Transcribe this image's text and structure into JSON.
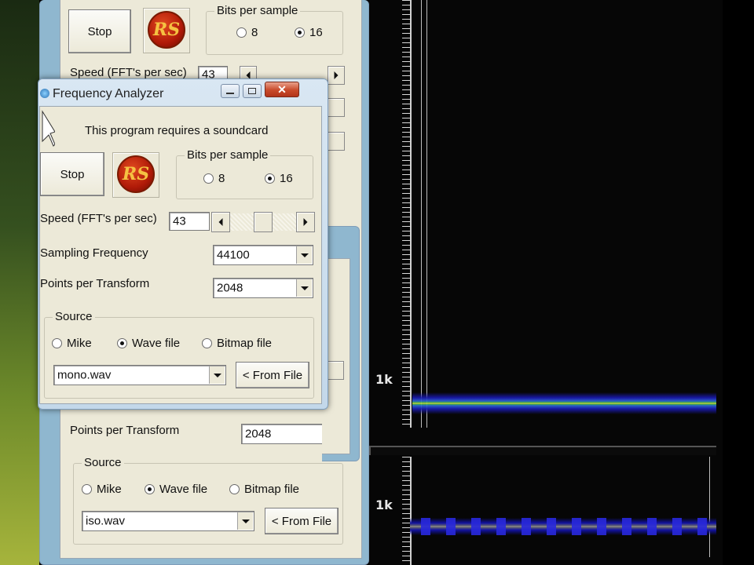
{
  "colors": {
    "window_face": "#ece9d8",
    "aero_frame": "#c3d8ea",
    "spectrogram_bg": "#060606",
    "band_yellow": "#f0e84a",
    "band_blue": "#1a1ab0",
    "logo_red": "#b01a08",
    "logo_gold": "#f5c242"
  },
  "back_window": {
    "stop_label": "Stop",
    "logo_text": "RS",
    "bits_group_title": "Bits per sample",
    "bits_8": "8",
    "bits_16": "16",
    "bits_selected": "16",
    "speed_label": "Speed (FFT's per sec)",
    "speed_value": "43",
    "points_label": "Points per Transform",
    "points_value": "2048",
    "source_group_title": "Source",
    "source_mike": "Mike",
    "source_wave": "Wave file",
    "source_bitmap": "Bitmap file",
    "source_selected": "Wave file",
    "file_value": "iso.wav",
    "from_file_label": "< From File"
  },
  "front_window": {
    "title": "Frequency Analyzer",
    "minimize_icon": "minimize-icon",
    "maximize_icon": "maximize-icon",
    "close_glyph": "✕",
    "notice": "This program requires a soundcard",
    "stop_label": "Stop",
    "logo_text": "RS",
    "bits_group_title": "Bits per sample",
    "bits_8": "8",
    "bits_16": "16",
    "bits_selected": "16",
    "speed_label": "Speed (FFT's per sec)",
    "speed_value": "43",
    "sampling_label": "Sampling Frequency",
    "sampling_value": "44100",
    "points_label": "Points per Transform",
    "points_value": "2048",
    "source_group_title": "Source",
    "source_mike": "Mike",
    "source_wave": "Wave file",
    "source_bitmap": "Bitmap file",
    "source_selected": "Wave file",
    "file_value": "mono.wav",
    "from_file_label": "< From File"
  },
  "spectrogram": {
    "top_axis_label": "1k",
    "bottom_axis_label": "1k"
  }
}
